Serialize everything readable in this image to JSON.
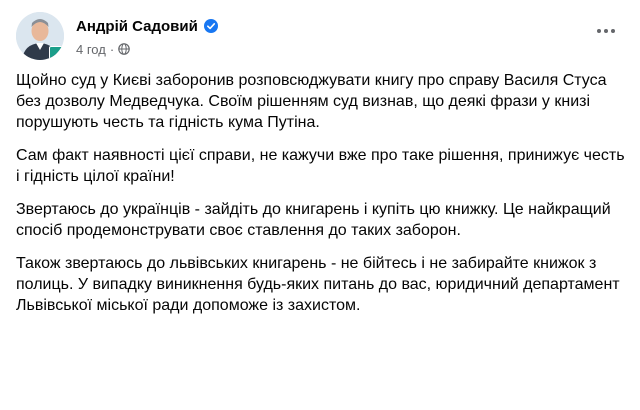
{
  "author": {
    "name": "Андрій Садовий",
    "time": "4 год",
    "separator": "·"
  },
  "icons": {
    "verified": "verified-badge-icon",
    "audience": "globe-icon",
    "more": "more-options-icon"
  },
  "colors": {
    "verified": "#1877f2",
    "meta": "#65676b",
    "text": "#050505"
  },
  "post": {
    "paragraphs": [
      "Щойно суд у Києві заборонив розповсюджувати книгу про справу Василя Стуса без дозволу Медведчука. Своїм рішенням суд визнав, що деякі фрази у книзі порушують честь та гідність кума Путіна.",
      "Сам факт наявності цієї справи, не кажучи вже про таке рішення, принижує честь і гідність цілої країни!",
      "Звертаюсь до українців - зайдіть до книгарень і купіть цю книжку. Це найкращий спосіб продемонструвати своє ставлення до таких заборон.",
      "Також звертаюсь до львівських книгарень - не бійтесь і не забирайте книжок з полиць. У випадку виникнення будь-яких питань до вас, юридичний департамент Львівської міської ради допоможе із захистом."
    ]
  }
}
